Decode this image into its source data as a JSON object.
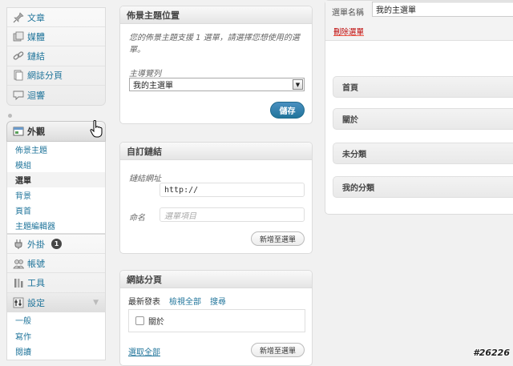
{
  "sidebar": {
    "top_items": [
      {
        "label": "文章",
        "icon": "pin-icon"
      },
      {
        "label": "媒體",
        "icon": "media-icon"
      },
      {
        "label": "鏈結",
        "icon": "link-icon"
      },
      {
        "label": "網誌分頁",
        "icon": "pages-icon"
      },
      {
        "label": "迴響",
        "icon": "comments-icon"
      }
    ],
    "appearance": {
      "label": "外觀",
      "submenu": [
        "佈景主題",
        "模組",
        "選單",
        "背景",
        "頁首",
        "主題編輯器"
      ],
      "current": "選單"
    },
    "bottom_items": [
      {
        "label": "外掛",
        "icon": "plugins-icon",
        "badge": "1"
      },
      {
        "label": "帳號",
        "icon": "users-icon"
      },
      {
        "label": "工具",
        "icon": "tools-icon"
      },
      {
        "label": "設定",
        "icon": "settings-icon"
      }
    ],
    "settings_submenu": [
      "一般",
      "寫作",
      "閱讀"
    ]
  },
  "theme_locations": {
    "title": "佈景主題位置",
    "description": "您的佈景主題支援 1 選單，請選擇您想使用的選單。",
    "field_label": "主導覽列",
    "selected": "我的主選單",
    "save_label": "儲存"
  },
  "custom_links": {
    "title": "自訂鏈結",
    "url_label": "鏈結網址",
    "url_value": "http://",
    "name_label": "命名",
    "name_placeholder": "選單項目",
    "add_label": "新增至選單"
  },
  "pages_box": {
    "title": "網誌分頁",
    "tabs": [
      "最新發表",
      "檢視全部",
      "搜尋"
    ],
    "page_item": "關於",
    "select_all": "選取全部",
    "add_label": "新增至選單"
  },
  "menu_editor": {
    "name_label": "選單名稱",
    "name_value": "我的主選單",
    "delete_label": "刪除選單",
    "items": [
      "首頁",
      "關於",
      "未分類",
      "我的分類"
    ]
  },
  "watermark": "#26226"
}
